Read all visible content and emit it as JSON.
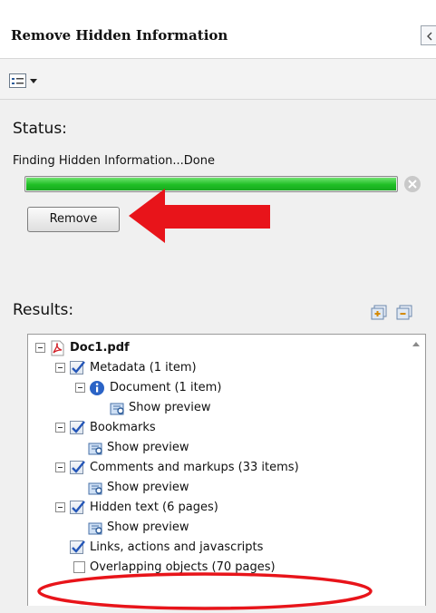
{
  "header": {
    "title": "Remove Hidden Information",
    "collapse_icon": "chevron-left-icon"
  },
  "toolbar": {
    "options_icon": "options-list-icon"
  },
  "status": {
    "label": "Status:",
    "message": "Finding Hidden Information...Done",
    "progress_fraction": 1.0,
    "progress_color": "#1fbf25",
    "remove_label": "Remove"
  },
  "annotations": {
    "arrow_color": "#e8141a",
    "ellipse_color": "#e8141a"
  },
  "results": {
    "label": "Results:",
    "tree": [
      {
        "label": "Doc1.pdf",
        "icon": "pdf-file-icon"
      },
      {
        "label": "Metadata (1 item)",
        "icon": "checkmark-icon"
      },
      {
        "label": "Document (1 item)",
        "icon": "info-icon"
      },
      {
        "label": "Show preview",
        "icon": "preview-icon"
      },
      {
        "label": "Bookmarks",
        "icon": "checkmark-icon"
      },
      {
        "label": "Show preview",
        "icon": "preview-icon"
      },
      {
        "label": "Comments and markups (33 items)",
        "icon": "checkmark-icon"
      },
      {
        "label": "Show preview",
        "icon": "preview-icon"
      },
      {
        "label": "Hidden text (6 pages)",
        "icon": "checkmark-icon"
      },
      {
        "label": "Show preview",
        "icon": "preview-icon"
      },
      {
        "label": "Links, actions and javascripts",
        "icon": "checkmark-icon"
      },
      {
        "label": "Overlapping objects (70 pages)",
        "icon": "checkbox-empty-icon"
      }
    ]
  }
}
